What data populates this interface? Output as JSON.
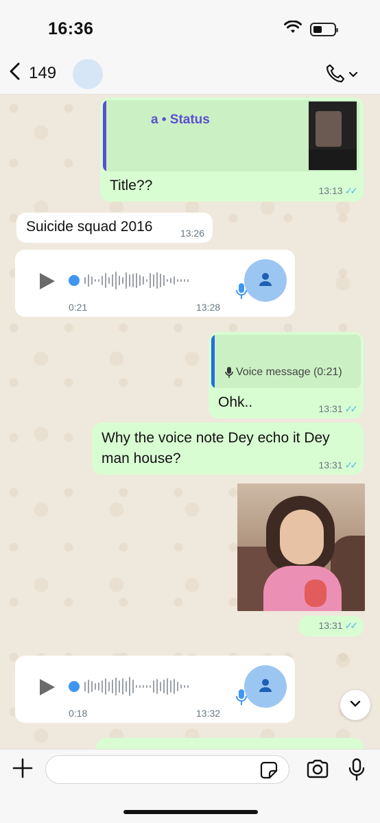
{
  "status_bar": {
    "time": "16:36"
  },
  "header": {
    "back_count": "149"
  },
  "messages": {
    "m1": {
      "quote_title": "a • Status",
      "text": "Title??",
      "time": "13:13",
      "ticks": "✓✓"
    },
    "m2": {
      "text": "Suicide squad 2016",
      "time": "13:26"
    },
    "m3": {
      "duration": "0:21",
      "time": "13:28"
    },
    "m4": {
      "quote_text": "Voice message (0:21)",
      "text": "Ohk..",
      "time": "13:31",
      "ticks": "✓✓"
    },
    "m5": {
      "text_line1": "Why the voice note Dey echo it Dey",
      "text_line2": "man house?",
      "time": "13:31",
      "ticks": "✓✓"
    },
    "m6": {
      "time": "13:31",
      "ticks": "✓✓"
    },
    "m7": {
      "duration": "0:18",
      "time": "13:32"
    }
  },
  "input": {
    "placeholder": ""
  },
  "colors": {
    "outgoing_bubble": "#d9fdd3",
    "incoming_bubble": "#ffffff",
    "read_ticks": "#53bdeb",
    "status_accent": "#5b4fd1"
  },
  "icons": [
    "wifi-icon",
    "battery-icon",
    "back-chevron-icon",
    "phone-icon",
    "chevron-down-icon",
    "play-icon",
    "mic-icon",
    "person-icon",
    "scroll-down-icon",
    "plus-icon",
    "sticker-icon",
    "camera-icon"
  ]
}
